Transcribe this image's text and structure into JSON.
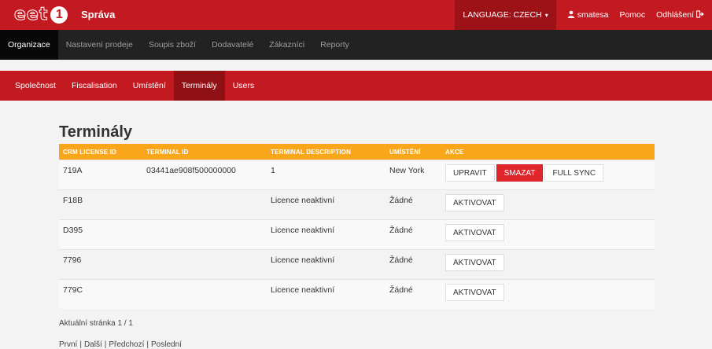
{
  "brand": {
    "logo_text": "eet",
    "logo_badge": "1",
    "app_title": "Správa"
  },
  "topbar": {
    "language_label": "LANGUAGE: CZECH",
    "user": "smatesa",
    "help": "Pomoc",
    "logout": "Odhlášení"
  },
  "main_nav": [
    {
      "label": "Organizace",
      "active": true
    },
    {
      "label": "Nastavení prodeje",
      "active": false
    },
    {
      "label": "Soupis zboží",
      "active": false
    },
    {
      "label": "Dodavatelé",
      "active": false
    },
    {
      "label": "Zákazníci",
      "active": false
    },
    {
      "label": "Reporty",
      "active": false
    }
  ],
  "sub_nav": [
    {
      "label": "Společnost",
      "active": false
    },
    {
      "label": "Fiscalisation",
      "active": false
    },
    {
      "label": "Umístění",
      "active": false
    },
    {
      "label": "Terminály",
      "active": true
    },
    {
      "label": "Users",
      "active": false
    }
  ],
  "page": {
    "title": "Terminály"
  },
  "table": {
    "columns": [
      "CRM LICENSE ID",
      "TERMINAL ID",
      "TERMINAL DESCRIPTION",
      "UMÍSTĚNÍ",
      "AKCE"
    ],
    "rows": [
      {
        "crm": "719A",
        "terminal_id": "03441ae908f500000000",
        "description": "1",
        "location": "New York",
        "actions": [
          "UPRAVIT",
          "SMAZAT",
          "FULL SYNC"
        ]
      },
      {
        "crm": "F18B",
        "terminal_id": "",
        "description": "Licence neaktivní",
        "location": "Žádné",
        "actions": [
          "AKTIVOVAT"
        ]
      },
      {
        "crm": "D395",
        "terminal_id": "",
        "description": "Licence neaktivní",
        "location": "Žádné",
        "actions": [
          "AKTIVOVAT"
        ]
      },
      {
        "crm": "7796",
        "terminal_id": "",
        "description": "Licence neaktivní",
        "location": "Žádné",
        "actions": [
          "AKTIVOVAT"
        ]
      },
      {
        "crm": "779C",
        "terminal_id": "",
        "description": "Licence neaktivní",
        "location": "Žádné",
        "actions": [
          "AKTIVOVAT"
        ]
      }
    ]
  },
  "pager": {
    "info": "Aktuální stránka 1 / 1",
    "first": "První",
    "next": "Další",
    "prev": "Předchozí",
    "last": "Poslední"
  },
  "colors": {
    "brand_red": "#c31a22",
    "nav_dark": "#222222",
    "header_orange": "#f9a61b",
    "danger": "#e0262d"
  },
  "icons": {
    "user": "user-icon",
    "logout": "logout-icon",
    "caret": "caret-down-icon"
  }
}
